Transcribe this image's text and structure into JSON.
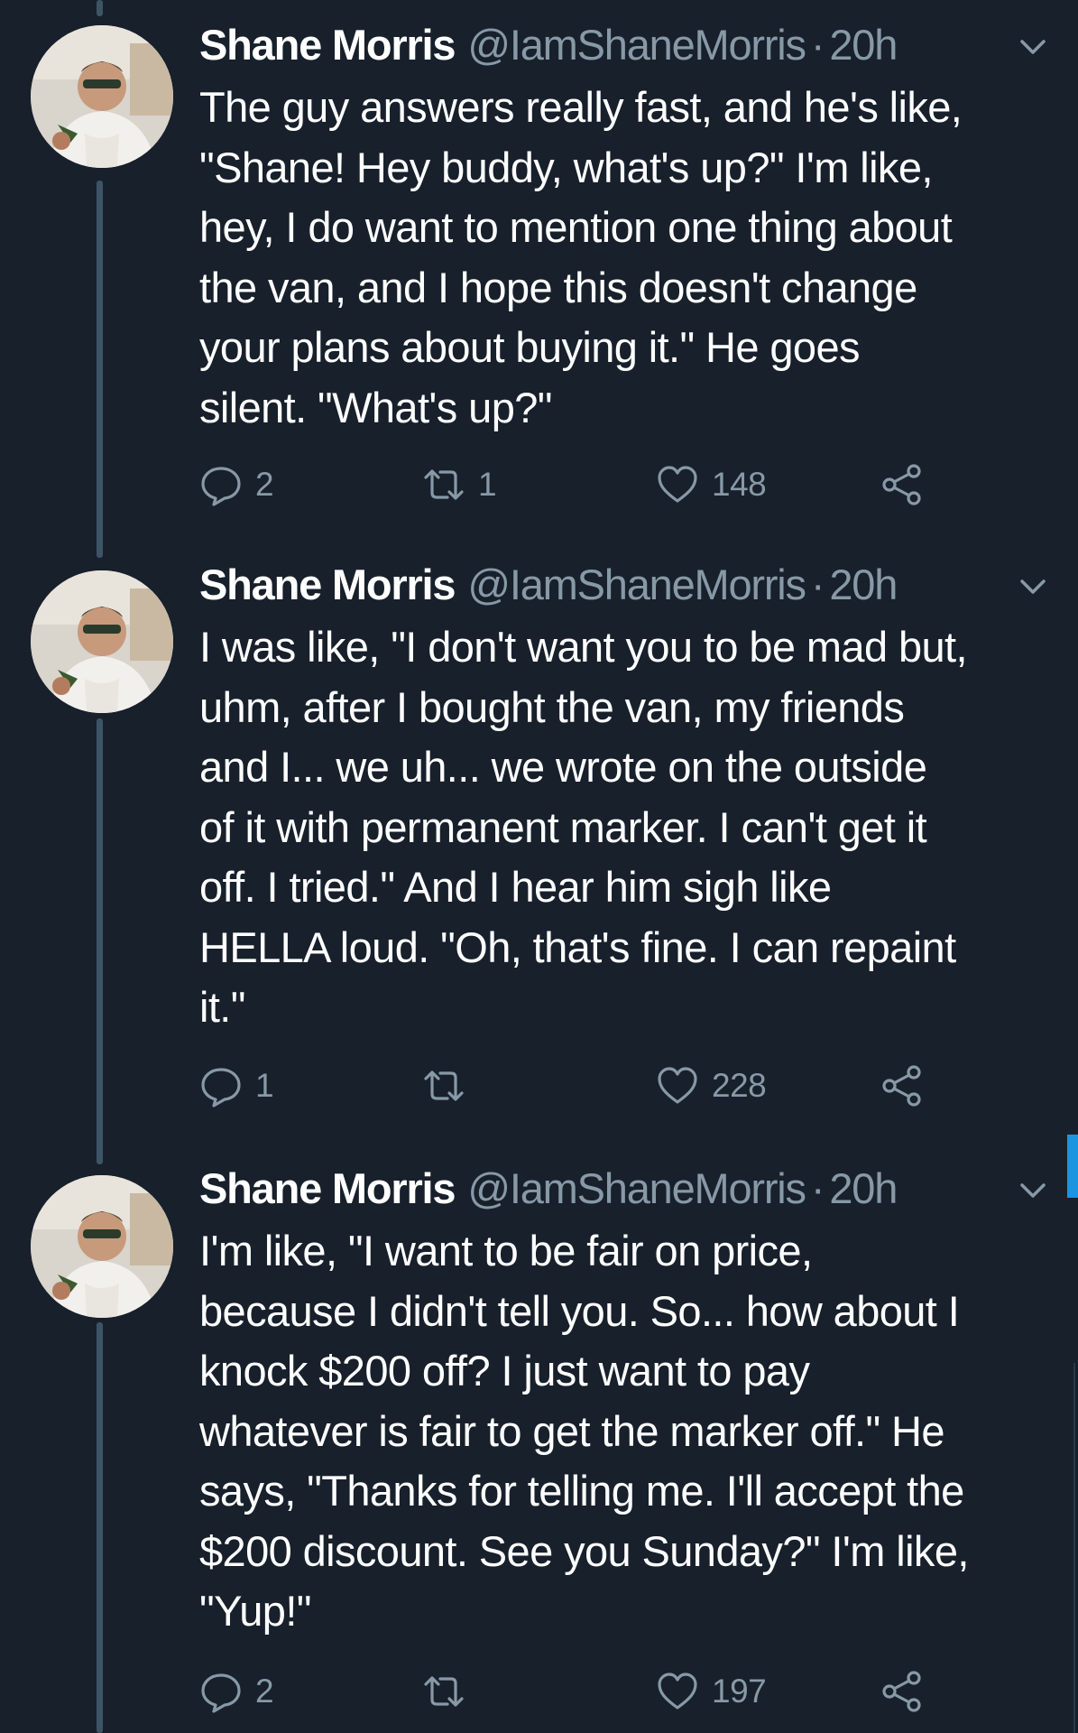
{
  "tweets": [
    {
      "name": "Shane Morris",
      "handle": "@IamShaneMorris",
      "dot": "·",
      "time": "20h",
      "text": "The guy answers really fast, and he's like,\n\"Shane! Hey buddy, what's up?\" I'm like,\nhey, I do want to mention one thing about\nthe van, and I hope this doesn't change\nyour plans about buying it.\" He goes\nsilent. \"What's up?\"",
      "replies": "2",
      "retweets": "1",
      "likes": "148"
    },
    {
      "name": "Shane Morris",
      "handle": "@IamShaneMorris",
      "dot": "·",
      "time": "20h",
      "text": "I was like, \"I don't want you to be mad but,\nuhm, after I bought the van, my friends\nand I... we uh... we wrote on the outside\nof it with permanent marker. I can't get it\noff. I tried.\" And I hear him sigh like\nHELLA loud. \"Oh, that's fine. I can repaint\nit.\"",
      "replies": "1",
      "retweets": "",
      "likes": "228"
    },
    {
      "name": "Shane Morris",
      "handle": "@IamShaneMorris",
      "dot": "·",
      "time": "20h",
      "text": "I'm like, \"I want to be fair on price,\nbecause I didn't tell you. So... how about I\nknock $200 off? I just want to pay\nwhatever is fair to get the marker off.\" He\nsays, \"Thanks for telling me. I'll accept the\n$200 discount. See you Sunday?\" I'm like,\n\"Yup!\"",
      "replies": "2",
      "retweets": "",
      "likes": "197"
    }
  ],
  "icons": {
    "reply": "reply-icon",
    "retweet": "retweet-icon",
    "like": "heart-icon",
    "share": "share-icon",
    "caret": "chevron-down-icon"
  },
  "colors": {
    "background": "#17202b",
    "secondary_text": "#8899a6",
    "thread_line": "#3d5466",
    "accent": "#1b95e0"
  }
}
